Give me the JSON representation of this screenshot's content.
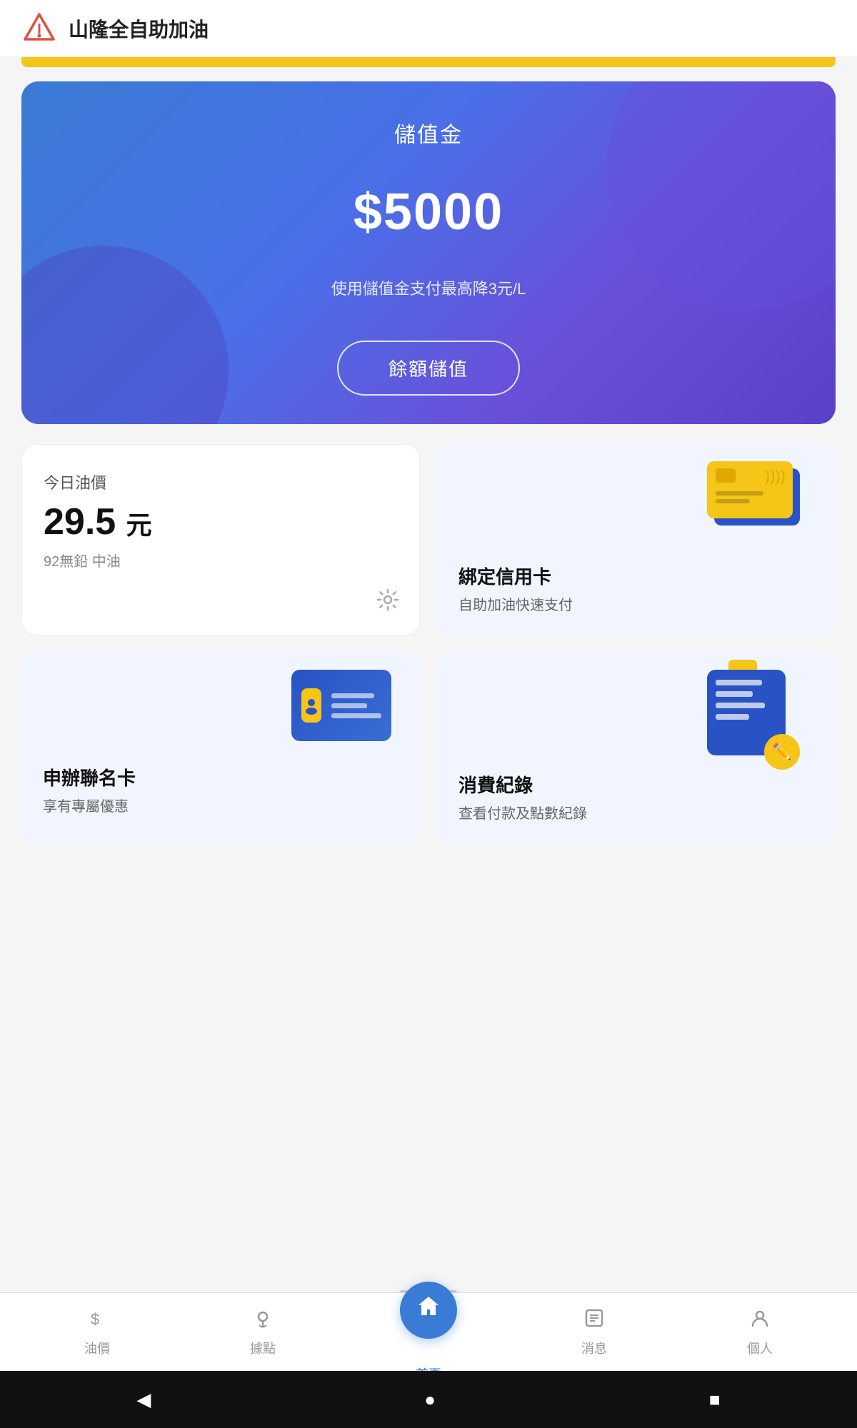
{
  "appTitle": "山隆全自助加油",
  "yellowBar": true,
  "balanceCard": {
    "label": "儲值金",
    "amount": "$5000",
    "desc": "使用儲值金支付最高降3元/L",
    "topupBtn": "餘額儲值"
  },
  "oilPrice": {
    "sectionTitle": "今日油價",
    "value": "29.5",
    "unit": "元",
    "type": "92無鉛 中油"
  },
  "creditCard": {
    "label": "綁定信用卡",
    "sublabel": "自助加油快速支付"
  },
  "idCard": {
    "label": "申辦聯名卡",
    "sublabel": "享有專屬優惠"
  },
  "receipt": {
    "label": "消費紀錄",
    "sublabel": "查看付款及點數紀錄"
  },
  "bottomNav": {
    "items": [
      {
        "label": "油價",
        "icon": "$",
        "active": false
      },
      {
        "label": "據點",
        "icon": "⊕",
        "active": false
      },
      {
        "label": "首頁",
        "icon": "⌂",
        "active": true
      },
      {
        "label": "消息",
        "icon": "⊟",
        "active": false
      },
      {
        "label": "個人",
        "icon": "⊙",
        "active": false
      }
    ]
  },
  "androidNav": {
    "back": "◀",
    "home": "●",
    "square": "■"
  }
}
